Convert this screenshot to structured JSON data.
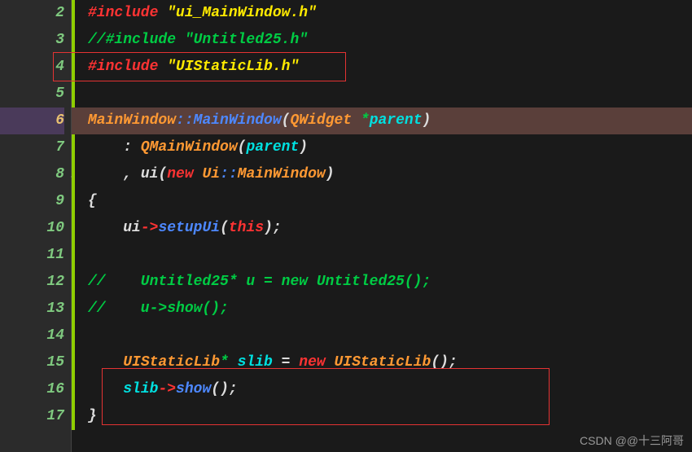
{
  "gutter": {
    "lines": [
      "2",
      "3",
      "4",
      "5",
      "6",
      "7",
      "8",
      "9",
      "10",
      "11",
      "12",
      "13",
      "14",
      "15",
      "16",
      "17"
    ],
    "current": "6",
    "fold_on": "8"
  },
  "code": {
    "l2": {
      "preproc": "#include ",
      "str": "\"ui_MainWindow.h\""
    },
    "l3": {
      "comment": "//#include \"Untitled25.h\""
    },
    "l4": {
      "preproc": "#include ",
      "str": "\"UIStaticLib.h\""
    },
    "l5": {
      "blank": ""
    },
    "l6": {
      "cls": "MainWindow",
      "scope": "::",
      "ctor": "MainWindow",
      "lp": "(",
      "ptype": "QWidget ",
      "star": "*",
      "pname": "parent",
      "rp": ")"
    },
    "l7": {
      "indent": "    ",
      "colon": ": ",
      "base": "QMainWindow",
      "lp": "(",
      "arg": "parent",
      "rp": ")"
    },
    "l8": {
      "indent": "    ",
      "comma": ", ",
      "field": "ui",
      "lp": "(",
      "kw": "new ",
      "ns": "Ui",
      "scope": "::",
      "type": "MainWindow",
      "rp": ")"
    },
    "l9": {
      "brace": "{"
    },
    "l10": {
      "indent": "    ",
      "obj": "ui",
      "arrow": "->",
      "method": "setupUi",
      "lp": "(",
      "this": "this",
      "rp": ")",
      "semi": ";"
    },
    "l11": {
      "blank": ""
    },
    "l12": {
      "comment": "//    Untitled25* u = new Untitled25();"
    },
    "l13": {
      "comment": "//    u->show();"
    },
    "l14": {
      "blank": ""
    },
    "l15": {
      "indent": "    ",
      "type": "UIStaticLib",
      "star": "* ",
      "var": "slib ",
      "eq": "= ",
      "kw": "new ",
      "type2": "UIStaticLib",
      "lp": "(",
      "rp": ")",
      "semi": ";"
    },
    "l16": {
      "indent": "    ",
      "obj": "slib",
      "arrow": "->",
      "method": "show",
      "lp": "(",
      "rp": ")",
      "semi": ";"
    },
    "l17": {
      "brace": "}"
    }
  },
  "watermark": "CSDN @@十三阿哥"
}
